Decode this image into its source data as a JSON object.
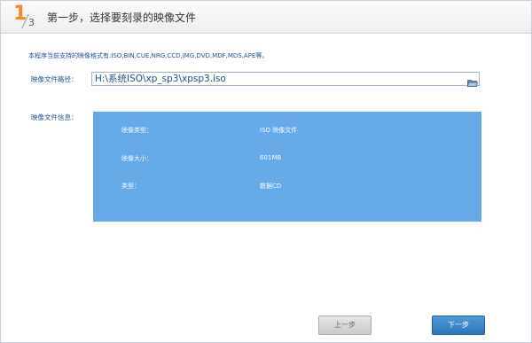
{
  "header": {
    "step_current": "1",
    "step_total": "3",
    "title": "第一步，选择要刻录的映像文件"
  },
  "support_text": "本程序当前支持的映像格式有:ISO,BIN,CUE,NRG,CCD,IMG,DVD,MDF,MDS,APE等。",
  "path": {
    "label": "映像文件路径：",
    "value": "H:\\系统ISO\\xp_sp3\\xpsp3.iso",
    "browse_icon": "folder-open-icon"
  },
  "info": {
    "label": "映像文件信息：",
    "rows": [
      {
        "key": "映像类型：",
        "value": "ISO 映像文件"
      },
      {
        "key": "映像大小：",
        "value": "601MB"
      },
      {
        "key": "类型：",
        "value": "数据CD"
      }
    ]
  },
  "buttons": {
    "prev": "上一步",
    "next": "下一步"
  },
  "colors": {
    "accent_orange": "#f08a24",
    "label_blue": "#1b4f8c",
    "info_box": "#65a9e6",
    "next_button": "#2c73b8"
  }
}
